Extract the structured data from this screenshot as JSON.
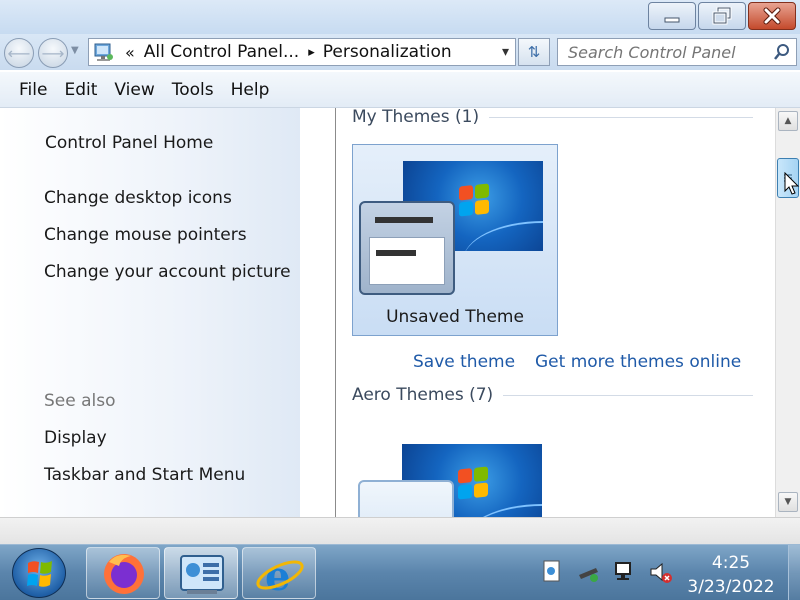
{
  "window": {
    "buttons": {
      "minimize": "minimize",
      "maximize": "restore",
      "close": "close"
    }
  },
  "address": {
    "chevron": "«",
    "crumbs": [
      "All Control Panel...",
      "Personalization"
    ],
    "separator": "▸",
    "dropdown": "▾",
    "search_placeholder": "Search Control Panel"
  },
  "menu": [
    "File",
    "Edit",
    "View",
    "Tools",
    "Help"
  ],
  "left_pane": {
    "home": "Control Panel Home",
    "links": [
      "Change desktop icons",
      "Change mouse pointers",
      "Change your account picture"
    ],
    "see_also": "See also",
    "see_also_links": [
      "Display",
      "Taskbar and Start Menu"
    ]
  },
  "content": {
    "my_themes_header": "My Themes (1)",
    "selected_theme": "Unsaved Theme",
    "save_theme": "Save theme",
    "get_more": "Get more themes online",
    "aero_header": "Aero Themes (7)"
  },
  "scroll": {
    "up": "▲",
    "down": "▼"
  },
  "taskbar": {
    "apps": [
      "firefox-icon",
      "control-panel-icon",
      "internet-explorer-icon"
    ],
    "time": "4:25",
    "date": "3/23/2022"
  },
  "colors": {
    "link": "#1f5aa8",
    "close_red": "#c44a2c",
    "taskbar": "#5b85ac"
  }
}
